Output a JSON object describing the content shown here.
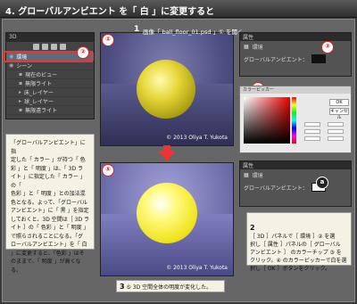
{
  "title": "4. グローバルアンビエント を「 白 」に変更すると",
  "panel3d": {
    "header": "3D",
    "items": [
      {
        "label": "環境",
        "selected": true
      },
      {
        "label": "シーン",
        "selected": false
      },
      {
        "label": "現在のビュー",
        "selected": false
      },
      {
        "label": "無限ライト",
        "selected": false
      },
      {
        "label": "床_レイヤー",
        "selected": false
      },
      {
        "label": "球_レイヤー",
        "selected": false
      },
      {
        "label": "無限遠ライト",
        "selected": false
      }
    ]
  },
  "markers": {
    "m1": "①",
    "m2": "②",
    "m3": "③",
    "m4": "④",
    "m5": "⑤",
    "ma": "a"
  },
  "steps": {
    "s1_num": "1",
    "s1_text": "画像「 ball_floor_01.psd 」① を開く。",
    "s2_num": "2",
    "s2_text": "［ 3D ］パネルで［ 環境 ］② を選\n択し［ 属性 ］パネルの［ グローバル\nアンビエント ］ のカラーチップ ③ を\nクリック。④ のカラーピッカーで白を選\n択し［ OK ］ボタンをクリック。",
    "s3_num": "3",
    "s3_text": "⑤ 3D 空間全体の明度が変化した。"
  },
  "copyright": "© 2013 Oliya T. Yukota",
  "props_top": {
    "header": "属性",
    "env_label": "環境",
    "ambient_label": "グローバルアンビエント：",
    "swatch": "#111111"
  },
  "props_bottom": {
    "header": "属性",
    "env_label": "環境",
    "ambient_label": "グローバルアンビエント：",
    "swatch": "#ffffff"
  },
  "picker": {
    "title": "カラーピッカー",
    "ok": "OK",
    "cancel": "キャンセル"
  },
  "callout": "「グローバルアンビエント」に指\n定した「 カラー 」が持つ「 色\n彩 」と「 明度 」は、「 3D ラ\nイト 」に指定した「 カラー 」の「\n色彩 」と「 明度 」との加法混\n色となる。よって、「グローバル\nアンビエント」に「 黒 」を指定\nしておくと、3D 空間は［ 3D ラ\nイト ］の「 色彩 」と「 明度 」\nで照らされることになる。「グ\nローバルアンビエント」を「 白\n」に変更すると、「色彩 」はそ\nのままで、「 明度 」が高くなる。"
}
